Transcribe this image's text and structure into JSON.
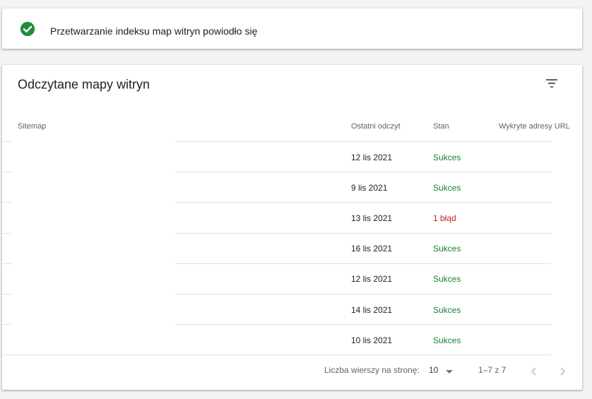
{
  "banner": {
    "icon": "check-circle-icon",
    "message": "Przetwarzanie indeksu map witryn powiodło się",
    "icon_color": "#1e8e3e"
  },
  "table": {
    "title": "Odczytane mapy witryn",
    "filter_icon": "filter-icon",
    "columns": {
      "sitemap": "Sitemap",
      "last_read": "Ostatni odczyt",
      "status": "Stan",
      "urls": "Wykryte adresy URL"
    },
    "rows": [
      {
        "sitemap": "",
        "last_read": "12 lis 2021",
        "status": "Sukces",
        "status_type": "success"
      },
      {
        "sitemap": "",
        "last_read": "9 lis 2021",
        "status": "Sukces",
        "status_type": "success"
      },
      {
        "sitemap": "",
        "last_read": "13 lis 2021",
        "status": "1 błąd",
        "status_type": "error"
      },
      {
        "sitemap": "",
        "last_read": "16 lis 2021",
        "status": "Sukces",
        "status_type": "success"
      },
      {
        "sitemap": "",
        "last_read": "12 lis 2021",
        "status": "Sukces",
        "status_type": "success"
      },
      {
        "sitemap": "",
        "last_read": "14 lis 2021",
        "status": "Sukces",
        "status_type": "success"
      },
      {
        "sitemap": "",
        "last_read": "10 lis 2021",
        "status": "Sukces",
        "status_type": "success"
      }
    ],
    "pagination": {
      "rows_per_page_label": "Liczba wierszy na stronę:",
      "rows_per_page_value": "10",
      "range": "1–7 z 7",
      "prev_icon": "chevron-left-icon",
      "next_icon": "chevron-right-icon",
      "dropdown_icon": "caret-down-icon"
    }
  },
  "colors": {
    "success": "#188038",
    "error": "#c5221f"
  }
}
